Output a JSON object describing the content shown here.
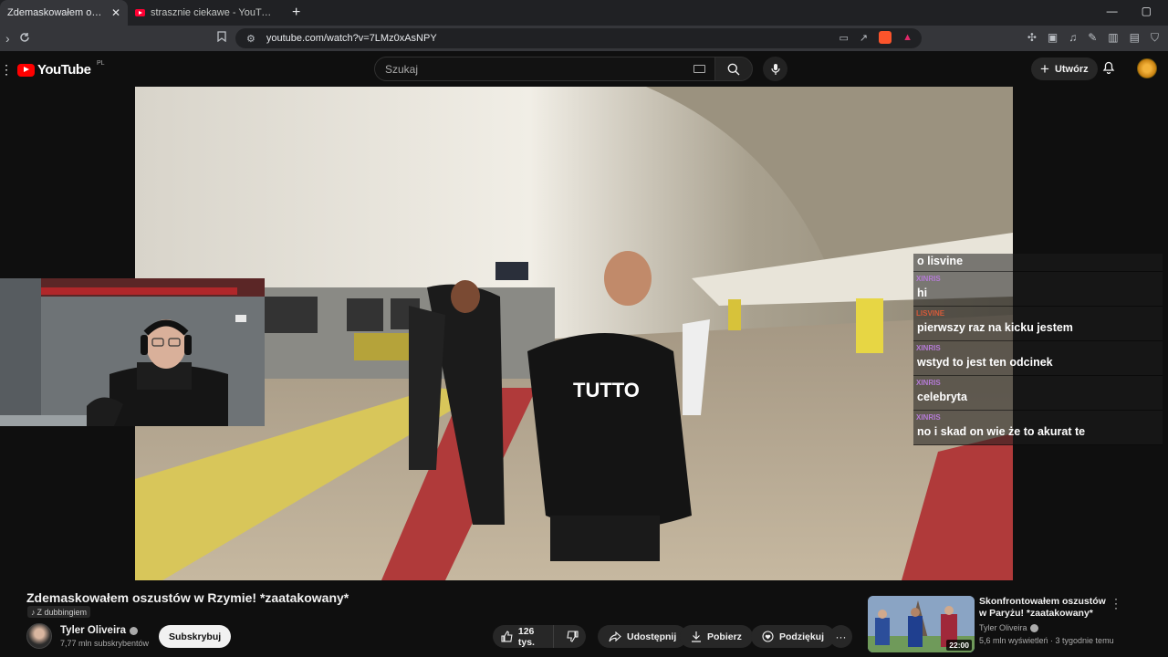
{
  "browser": {
    "tabs": [
      {
        "title": "Zdemaskowałem oszustów w",
        "close": "✕"
      },
      {
        "title": "strasznie ciekawe - YouTube"
      }
    ],
    "new_tab": "+",
    "window_controls": {
      "minimize": "—",
      "maximize": "▢"
    },
    "url": "youtube.com/watch?v=7LMz0xAsNPY"
  },
  "youtube": {
    "country_code": "PL",
    "logo_text": "YouTube",
    "search_placeholder": "Szukaj",
    "create_label": "Utwórz"
  },
  "chat": [
    {
      "user": "",
      "message": "o lisvine"
    },
    {
      "user": "XINRIS",
      "message": "hi"
    },
    {
      "user": "LISVINE",
      "message": "pierwszy raz na kicku jestem"
    },
    {
      "user": "XINRIS",
      "message": "wstyd to jest ten odcinek"
    },
    {
      "user": "XINRIS",
      "message": "celebryta"
    },
    {
      "user": "XINRIS",
      "message": "no i skad on wie że to akurat te"
    }
  ],
  "video": {
    "title": "Zdemaskowałem oszustów w Rzymie! *zaatakowany*",
    "dubbing_label": "Z dubbingiem",
    "channel_name": "Tyler Oliveira",
    "subscribers": "7,77 mln subskrybentów",
    "subscribe_label": "Subskrybuj",
    "likes": "126 tys.",
    "share_label": "Udostępnij",
    "download_label": "Pobierz",
    "thanks_label": "Podziękuj",
    "more": "···"
  },
  "recommended": {
    "title": "Skonfrontowałem oszustów w Paryżu! *zaatakowany*",
    "channel": "Tyler Oliveira",
    "meta": "5,6 mln wyświetleń · 3 tygodnie temu",
    "duration": "22:00"
  },
  "colors": {
    "background": "#0f0f0f",
    "youtube_red": "#ff0000",
    "chat_username": "#b57bd6"
  }
}
